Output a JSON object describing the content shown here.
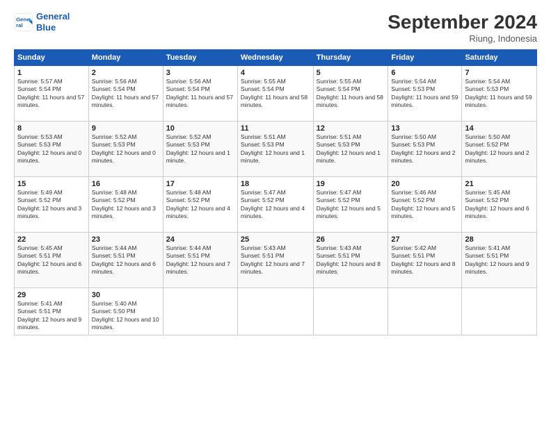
{
  "header": {
    "logo_line1": "General",
    "logo_line2": "Blue",
    "month": "September 2024",
    "location": "Riung, Indonesia"
  },
  "days_of_week": [
    "Sunday",
    "Monday",
    "Tuesday",
    "Wednesday",
    "Thursday",
    "Friday",
    "Saturday"
  ],
  "weeks": [
    [
      {
        "day": "1",
        "sunrise": "5:57 AM",
        "sunset": "5:54 PM",
        "daylight": "11 hours and 57 minutes."
      },
      {
        "day": "2",
        "sunrise": "5:56 AM",
        "sunset": "5:54 PM",
        "daylight": "11 hours and 57 minutes."
      },
      {
        "day": "3",
        "sunrise": "5:56 AM",
        "sunset": "5:54 PM",
        "daylight": "11 hours and 57 minutes."
      },
      {
        "day": "4",
        "sunrise": "5:55 AM",
        "sunset": "5:54 PM",
        "daylight": "11 hours and 58 minutes."
      },
      {
        "day": "5",
        "sunrise": "5:55 AM",
        "sunset": "5:54 PM",
        "daylight": "11 hours and 58 minutes."
      },
      {
        "day": "6",
        "sunrise": "5:54 AM",
        "sunset": "5:53 PM",
        "daylight": "11 hours and 59 minutes."
      },
      {
        "day": "7",
        "sunrise": "5:54 AM",
        "sunset": "5:53 PM",
        "daylight": "11 hours and 59 minutes."
      }
    ],
    [
      {
        "day": "8",
        "sunrise": "5:53 AM",
        "sunset": "5:53 PM",
        "daylight": "12 hours and 0 minutes."
      },
      {
        "day": "9",
        "sunrise": "5:52 AM",
        "sunset": "5:53 PM",
        "daylight": "12 hours and 0 minutes."
      },
      {
        "day": "10",
        "sunrise": "5:52 AM",
        "sunset": "5:53 PM",
        "daylight": "12 hours and 1 minute."
      },
      {
        "day": "11",
        "sunrise": "5:51 AM",
        "sunset": "5:53 PM",
        "daylight": "12 hours and 1 minute."
      },
      {
        "day": "12",
        "sunrise": "5:51 AM",
        "sunset": "5:53 PM",
        "daylight": "12 hours and 1 minute."
      },
      {
        "day": "13",
        "sunrise": "5:50 AM",
        "sunset": "5:53 PM",
        "daylight": "12 hours and 2 minutes."
      },
      {
        "day": "14",
        "sunrise": "5:50 AM",
        "sunset": "5:52 PM",
        "daylight": "12 hours and 2 minutes."
      }
    ],
    [
      {
        "day": "15",
        "sunrise": "5:49 AM",
        "sunset": "5:52 PM",
        "daylight": "12 hours and 3 minutes."
      },
      {
        "day": "16",
        "sunrise": "5:48 AM",
        "sunset": "5:52 PM",
        "daylight": "12 hours and 3 minutes."
      },
      {
        "day": "17",
        "sunrise": "5:48 AM",
        "sunset": "5:52 PM",
        "daylight": "12 hours and 4 minutes."
      },
      {
        "day": "18",
        "sunrise": "5:47 AM",
        "sunset": "5:52 PM",
        "daylight": "12 hours and 4 minutes."
      },
      {
        "day": "19",
        "sunrise": "5:47 AM",
        "sunset": "5:52 PM",
        "daylight": "12 hours and 5 minutes."
      },
      {
        "day": "20",
        "sunrise": "5:46 AM",
        "sunset": "5:52 PM",
        "daylight": "12 hours and 5 minutes."
      },
      {
        "day": "21",
        "sunrise": "5:45 AM",
        "sunset": "5:52 PM",
        "daylight": "12 hours and 6 minutes."
      }
    ],
    [
      {
        "day": "22",
        "sunrise": "5:45 AM",
        "sunset": "5:51 PM",
        "daylight": "12 hours and 6 minutes."
      },
      {
        "day": "23",
        "sunrise": "5:44 AM",
        "sunset": "5:51 PM",
        "daylight": "12 hours and 6 minutes."
      },
      {
        "day": "24",
        "sunrise": "5:44 AM",
        "sunset": "5:51 PM",
        "daylight": "12 hours and 7 minutes."
      },
      {
        "day": "25",
        "sunrise": "5:43 AM",
        "sunset": "5:51 PM",
        "daylight": "12 hours and 7 minutes."
      },
      {
        "day": "26",
        "sunrise": "5:43 AM",
        "sunset": "5:51 PM",
        "daylight": "12 hours and 8 minutes."
      },
      {
        "day": "27",
        "sunrise": "5:42 AM",
        "sunset": "5:51 PM",
        "daylight": "12 hours and 8 minutes."
      },
      {
        "day": "28",
        "sunrise": "5:41 AM",
        "sunset": "5:51 PM",
        "daylight": "12 hours and 9 minutes."
      }
    ],
    [
      {
        "day": "29",
        "sunrise": "5:41 AM",
        "sunset": "5:51 PM",
        "daylight": "12 hours and 9 minutes."
      },
      {
        "day": "30",
        "sunrise": "5:40 AM",
        "sunset": "5:50 PM",
        "daylight": "12 hours and 10 minutes."
      },
      null,
      null,
      null,
      null,
      null
    ]
  ]
}
